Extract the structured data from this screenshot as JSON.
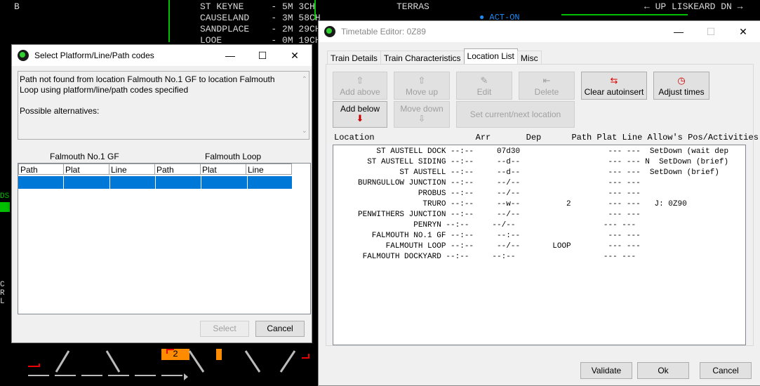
{
  "background": {
    "lines": [
      {
        "text": "ST KEYNE     - 5M 3CH",
        "row": 0
      },
      {
        "text": "CAUSELAND    - 3M 58CH",
        "row": 1
      },
      {
        "text": "SANDPLACE    - 2M 29CH",
        "row": 2
      },
      {
        "text": "LOOE         - 0M 19CH",
        "row": 3
      }
    ],
    "b_label": "B",
    "terras": "TERRAS",
    "act_on": "● ACT-ON",
    "up_liskeard": "← UP LISKEARD DN →",
    "platform_num": "2",
    "left_letters": "C\nR\nL",
    "ds_label": "DS"
  },
  "select_dialog": {
    "title": "Select Platform/Line/Path codes",
    "message_line1": "Path not found from location Falmouth No.1 GF to location Falmouth",
    "message_line2": "Loop using platform/line/path codes specified",
    "message_line3": "Possible alternatives:",
    "from_label": "Falmouth No.1 GF",
    "to_label": "Falmouth Loop",
    "columns": [
      "Path",
      "Plat",
      "Line",
      "Path",
      "Plat",
      "Line"
    ],
    "select_label": "Select",
    "cancel_label": "Cancel"
  },
  "timetable": {
    "title": "Timetable Editor: 0Z89",
    "tabs": [
      "Train Details",
      "Train Characteristics",
      "Location List",
      "Misc"
    ],
    "active_tab": "Location List",
    "buttons": {
      "add_above": "Add above",
      "move_up": "Move up",
      "edit": "Edit",
      "delete": "Delete",
      "clear_autoinsert": "Clear autoinsert",
      "adjust_times": "Adjust times",
      "add_below": "Add below",
      "move_down": "Move down",
      "set_current": "Set current/next location"
    },
    "list_header": "Location                    Arr       Dep      Path Plat Line Allow's Pos/Activities",
    "rows": [
      "         ST AUSTELL DOCK --:--     07d30                   --- ---  SetDown (wait dep",
      "       ST AUSTELL SIDING --:--     --d--                   --- --- N  SetDown (brief)",
      "              ST AUSTELL --:--     --d--                   --- ---  SetDown (brief)",
      "     BURNGULLOW JUNCTION --:--     --/--                   --- ---",
      "                  PROBUS --:--     --/--                   --- ---",
      "                   TRURO --:--     --w--          2        --- ---   J: 0Z90",
      "     PENWITHERS JUNCTION --:--     --/--                   --- ---",
      "                 PENRYN --:--     --/--                   --- ---",
      "        FALMOUTH NO.1 GF --:--     --:--                   --- ---",
      "           FALMOUTH LOOP --:--     --/--       LOOP        --- ---",
      "      FALMOUTH DOCKYARD --:--     --:--                   --- ---"
    ],
    "validate_label": "Validate",
    "ok_label": "Ok",
    "cancel_label": "Cancel"
  },
  "colors": {
    "accent": "#0078d7",
    "select_row": "#0078d7",
    "signal_green": "#00c000",
    "platform_orange": "#ff8c00"
  }
}
